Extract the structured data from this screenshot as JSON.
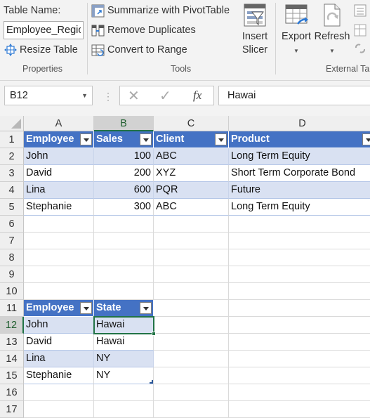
{
  "ribbon": {
    "table_name_label": "Table Name:",
    "table_name_value": "Employee_Regio",
    "resize_table": "Resize Table",
    "summarize_pivot": "Summarize with PivotTable",
    "remove_duplicates": "Remove Duplicates",
    "convert_to_range": "Convert to Range",
    "insert_slicer_line1": "Insert",
    "insert_slicer_line2": "Slicer",
    "export": "Export",
    "refresh": "Refresh",
    "groups": {
      "properties": "Properties",
      "tools": "Tools",
      "external": "External Ta"
    }
  },
  "formula_bar": {
    "name_box": "B12",
    "formula_value": "Hawai",
    "fx": "fx"
  },
  "columns": [
    "A",
    "B",
    "C",
    "D"
  ],
  "rows": [
    "1",
    "2",
    "3",
    "4",
    "5",
    "6",
    "7",
    "8",
    "9",
    "10",
    "11",
    "12",
    "13",
    "14",
    "15",
    "16",
    "17"
  ],
  "table1": {
    "headers": [
      "Employee",
      "Sales",
      "Client",
      "Product"
    ],
    "rows": [
      [
        "John",
        "100",
        "ABC",
        "Long Term Equity"
      ],
      [
        "David",
        "200",
        "XYZ",
        "Short Term Corporate Bond"
      ],
      [
        "Lina",
        "600",
        "PQR",
        "Future"
      ],
      [
        "Stephanie",
        "300",
        "ABC",
        "Long Term Equity"
      ]
    ]
  },
  "table2": {
    "headers": [
      "Employee",
      "State"
    ],
    "rows": [
      [
        "John",
        "Hawai"
      ],
      [
        "David",
        "Hawai"
      ],
      [
        "Lina",
        "NY"
      ],
      [
        "Stephanie",
        "NY"
      ]
    ]
  },
  "colors": {
    "header_blue": "#4472c4",
    "band_blue": "#d9e1f2",
    "selection_green": "#217346"
  }
}
